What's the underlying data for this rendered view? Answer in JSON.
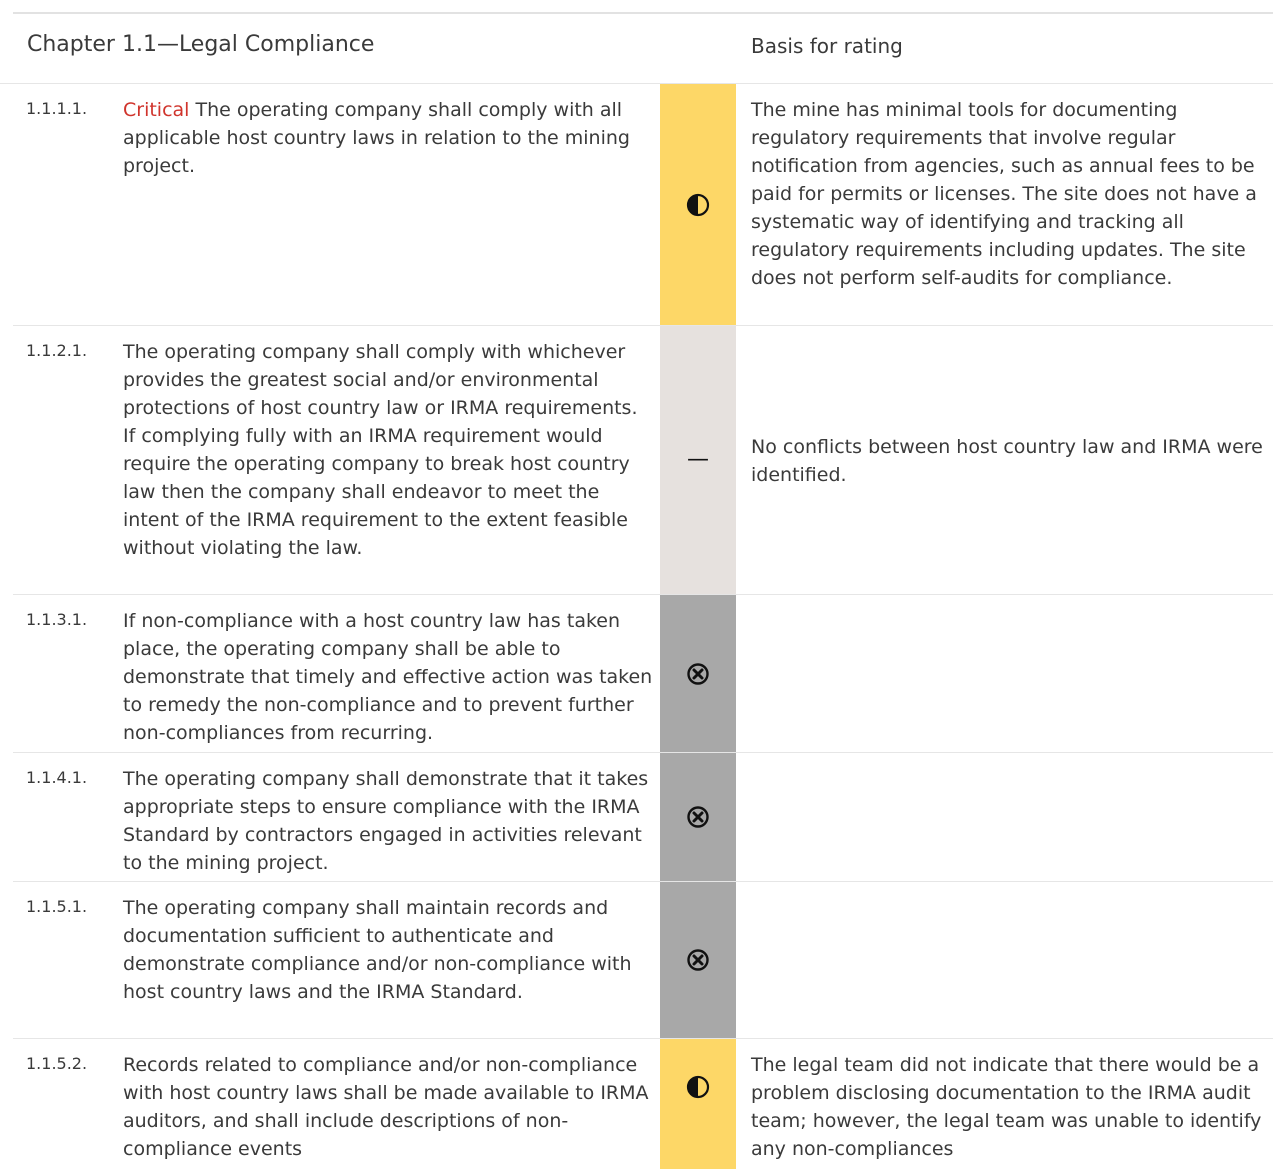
{
  "header": {
    "chapter_title": "Chapter 1.1—Legal Compliance",
    "basis_heading": "Basis for rating"
  },
  "colors": {
    "critical": "#d0342c",
    "partially_met": "#fdd767",
    "not_applicable": "#e6e1de",
    "not_met": "#a8a8a8"
  },
  "rows": [
    {
      "number": "1.1.1.1.",
      "critical_label": "Critical",
      "requirement": "The operating company shall comply with all applicable host country laws in relation to the mining project.",
      "rating_icon": "half-circle-icon",
      "basis": "The mine has minimal tools for documenting regulatory requirements that involve regular notification from agencies, such as annual fees to be paid for permits or licenses.  The site does not have a systematic way of identifying and tracking all regulatory requirements including updates.  The site does not perform self-audits for compliance."
    },
    {
      "number": "1.1.2.1.",
      "requirement": "The operating company shall comply with whichever provides the greatest social and/or environmental protections of host country law or IRMA requirements. If complying fully with an IRMA requirement would require the operating company to break host country law then the company shall endeavor to meet the intent of the IRMA requirement to the extent feasible without violating the law.",
      "rating_icon": "dash-icon",
      "rating_text": "—",
      "basis": "No conflicts between host country law and IRMA were identified."
    },
    {
      "number": "1.1.3.1.",
      "requirement": "If non-compliance with a host country law has taken place, the operating company shall be able to demonstrate that timely and effective action was taken to remedy the non-compliance and to prevent further non-compliances from recurring.",
      "rating_icon": "circled-x-icon",
      "basis": ""
    },
    {
      "number": "1.1.4.1.",
      "requirement": "The operating company shall demonstrate that it takes appropriate steps to ensure compliance with the IRMA Standard by contractors engaged in activities relevant to the mining project.",
      "rating_icon": "circled-x-icon",
      "basis": ""
    },
    {
      "number": "1.1.5.1.",
      "requirement": "The operating company shall maintain records and documentation sufficient to authenticate and demonstrate compliance and/or non-compliance with host country laws and the IRMA Standard.",
      "rating_icon": "circled-x-icon",
      "basis": ""
    },
    {
      "number": "1.1.5.2.",
      "requirement": "Records related to compliance and/or non-compliance with host country laws shall be made available to IRMA auditors, and shall include descriptions of non-compliance events",
      "rating_icon": "half-circle-icon",
      "basis": "The legal team did not indicate that there would be a problem disclosing documentation to the IRMA audit team; however, the legal team was unable to identify any non-compliances"
    }
  ]
}
